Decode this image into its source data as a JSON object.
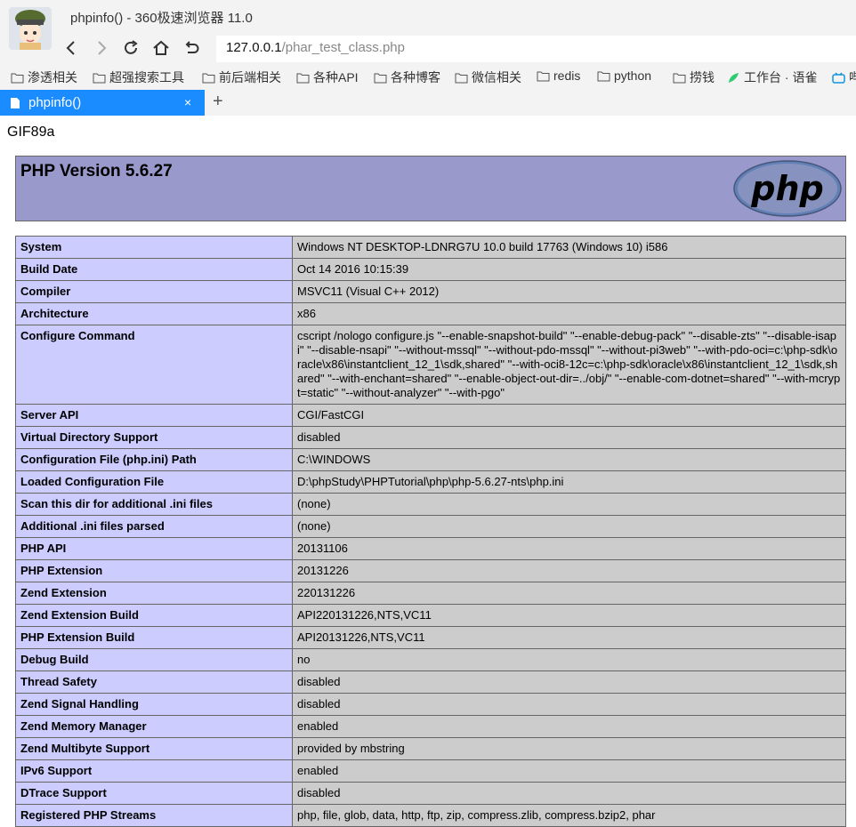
{
  "window": {
    "title": "phpinfo() - 360极速浏览器 11.0"
  },
  "address": {
    "host": "127.0.0.1",
    "path": "/phar_test_class.php"
  },
  "bookmarks": [
    {
      "label": "渗透相关"
    },
    {
      "label": "超强搜索工具"
    },
    {
      "label": "前后端相关"
    },
    {
      "label": "各种API"
    },
    {
      "label": "各种博客"
    },
    {
      "label": "微信相关"
    },
    {
      "label": "redis"
    },
    {
      "label": "python"
    },
    {
      "label": "捞钱"
    },
    {
      "label": "工作台 · 语雀"
    },
    {
      "label": "哔"
    }
  ],
  "tab": {
    "label": "phpinfo()",
    "close": "×",
    "new": "+"
  },
  "page": {
    "prefix": "GIF89a",
    "header": "PHP Version 5.6.27",
    "logo_text": "php",
    "rows": [
      {
        "label": "System",
        "value": "Windows NT DESKTOP-LDNRG7U 10.0 build 17763 (Windows 10) i586"
      },
      {
        "label": "Build Date",
        "value": "Oct 14 2016 10:15:39"
      },
      {
        "label": "Compiler",
        "value": "MSVC11 (Visual C++ 2012)"
      },
      {
        "label": "Architecture",
        "value": "x86"
      },
      {
        "label": "Configure Command",
        "value": "cscript /nologo configure.js \"--enable-snapshot-build\" \"--enable-debug-pack\" \"--disable-zts\" \"--disable-isapi\" \"--disable-nsapi\" \"--without-mssql\" \"--without-pdo-mssql\" \"--without-pi3web\" \"--with-pdo-oci=c:\\php-sdk\\oracle\\x86\\instantclient_12_1\\sdk,shared\" \"--with-oci8-12c=c:\\php-sdk\\oracle\\x86\\instantclient_12_1\\sdk,shared\" \"--with-enchant=shared\" \"--enable-object-out-dir=../obj/\" \"--enable-com-dotnet=shared\" \"--with-mcrypt=static\" \"--without-analyzer\" \"--with-pgo\""
      },
      {
        "label": "Server API",
        "value": "CGI/FastCGI"
      },
      {
        "label": "Virtual Directory Support",
        "value": "disabled"
      },
      {
        "label": "Configuration File (php.ini) Path",
        "value": "C:\\WINDOWS"
      },
      {
        "label": "Loaded Configuration File",
        "value": "D:\\phpStudy\\PHPTutorial\\php\\php-5.6.27-nts\\php.ini"
      },
      {
        "label": "Scan this dir for additional .ini files",
        "value": "(none)"
      },
      {
        "label": "Additional .ini files parsed",
        "value": "(none)"
      },
      {
        "label": "PHP API",
        "value": "20131106"
      },
      {
        "label": "PHP Extension",
        "value": "20131226"
      },
      {
        "label": "Zend Extension",
        "value": "220131226"
      },
      {
        "label": "Zend Extension Build",
        "value": "API220131226,NTS,VC11"
      },
      {
        "label": "PHP Extension Build",
        "value": "API20131226,NTS,VC11"
      },
      {
        "label": "Debug Build",
        "value": "no"
      },
      {
        "label": "Thread Safety",
        "value": "disabled"
      },
      {
        "label": "Zend Signal Handling",
        "value": "disabled"
      },
      {
        "label": "Zend Memory Manager",
        "value": "enabled"
      },
      {
        "label": "Zend Multibyte Support",
        "value": "provided by mbstring"
      },
      {
        "label": "IPv6 Support",
        "value": "enabled"
      },
      {
        "label": "DTrace Support",
        "value": "disabled"
      },
      {
        "label": "Registered PHP Streams",
        "value": "php, file, glob, data, http, ftp, zip, compress.zlib, compress.bzip2, phar"
      }
    ]
  }
}
